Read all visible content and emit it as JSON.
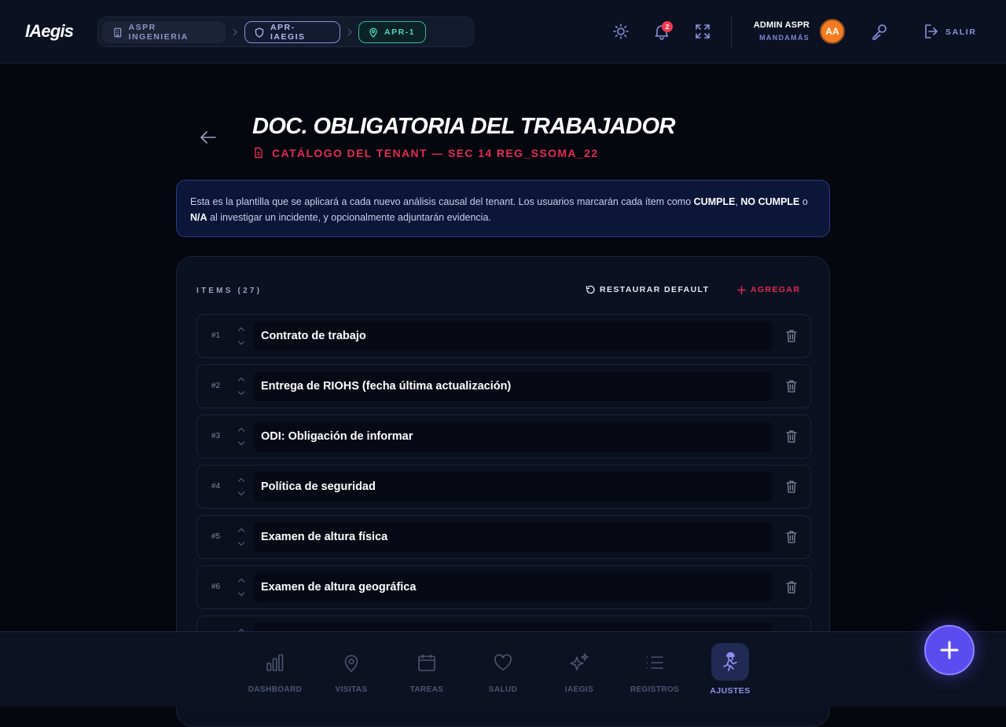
{
  "header": {
    "logo": "IAegis",
    "breadcrumbs": [
      {
        "label": "ASPR INGENIERIA",
        "icon": "building-icon"
      },
      {
        "label": "APR-IAEGIS",
        "icon": "shield-icon"
      },
      {
        "label": "APR-1",
        "icon": "map-pin-icon"
      }
    ],
    "notifications_count": "2",
    "user": {
      "name": "ADMIN ASPR",
      "role": "MANDAMÁS",
      "initials": "AA"
    },
    "logout_label": "SALIR"
  },
  "page": {
    "title": "DOC. OBLIGATORIA DEL TRABAJADOR",
    "subtitle": "CATÁLOGO DEL TENANT — SEC 14 REG_SSOMA_22"
  },
  "info": {
    "part1": "Esta es la plantilla que se aplicará a cada nuevo análisis causal del tenant. Los usuarios marcarán cada ítem como ",
    "cumple": "CUMPLE",
    "comma": ", ",
    "no_cumple": "NO CUMPLE",
    "or": " o",
    "na": "N/A",
    "part2": " al investigar un incidente, y opcionalmente adjuntarán evidencia."
  },
  "items_panel": {
    "title": "ITEMS (27)",
    "restore_label": "RESTAURAR DEFAULT",
    "add_label": "AGREGAR",
    "items": [
      {
        "num": "#1",
        "label": "Contrato de trabajo"
      },
      {
        "num": "#2",
        "label": "Entrega de RIOHS (fecha última actualización)"
      },
      {
        "num": "#3",
        "label": "ODI: Obligación de informar"
      },
      {
        "num": "#4",
        "label": "Política de seguridad"
      },
      {
        "num": "#5",
        "label": "Examen de altura física"
      },
      {
        "num": "#6",
        "label": "Examen de altura geográfica"
      }
    ]
  },
  "bottom_nav": [
    {
      "label": "DASHBOARD",
      "icon": "bar-chart-icon"
    },
    {
      "label": "VISITAS",
      "icon": "map-pin-icon"
    },
    {
      "label": "TAREAS",
      "icon": "calendar-icon"
    },
    {
      "label": "SALUD",
      "icon": "heart-icon"
    },
    {
      "label": "IAEGIS",
      "icon": "sparkles-icon"
    },
    {
      "label": "REGISTROS",
      "icon": "list-icon"
    },
    {
      "label": "AJUSTES",
      "icon": "worker-icon",
      "active": true
    }
  ],
  "colors": {
    "accent": "#5b4cf0",
    "danger": "#e42a4f",
    "teal": "#4fd6bf",
    "background": "#05070f"
  }
}
